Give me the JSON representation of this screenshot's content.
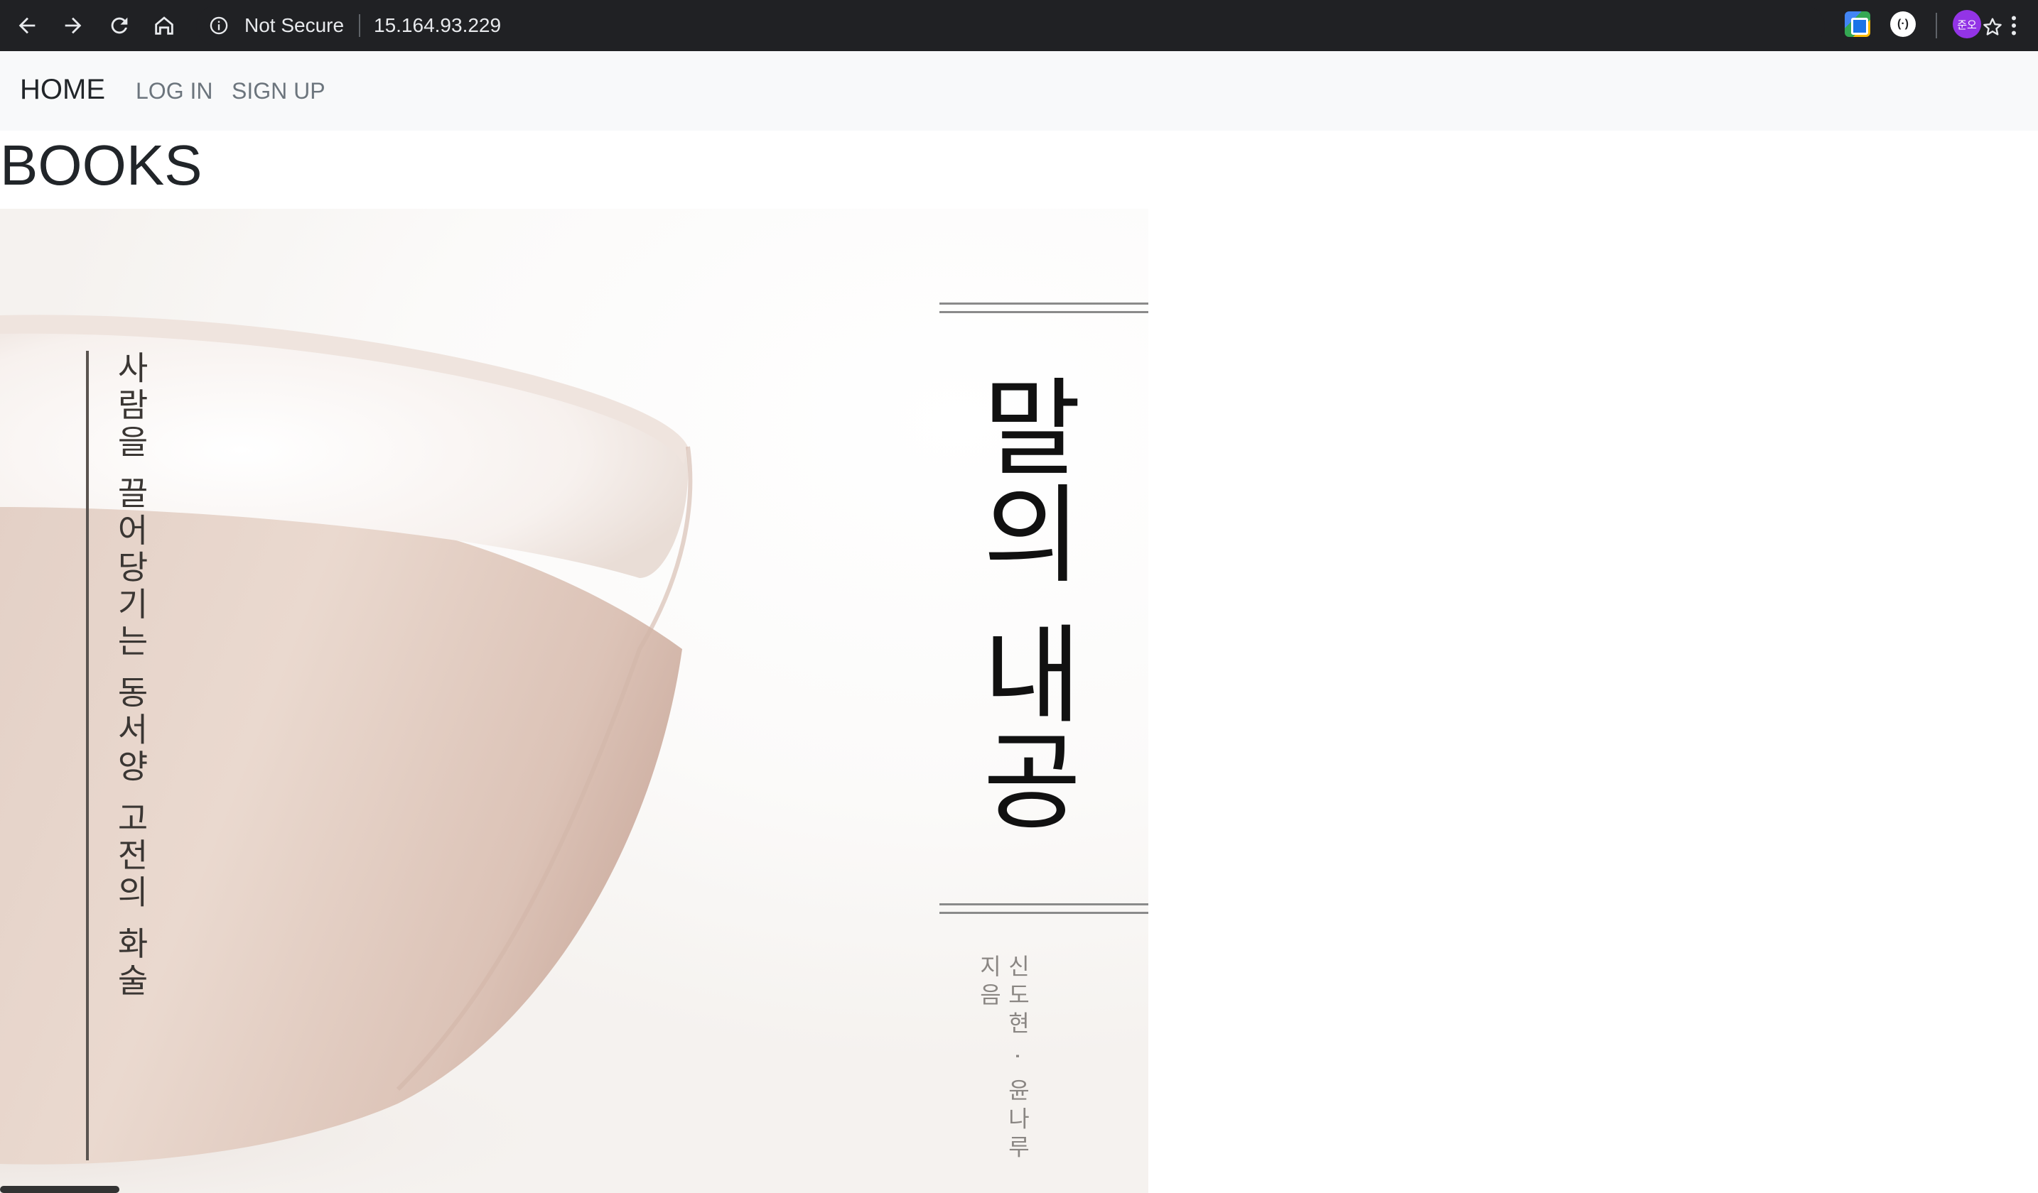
{
  "browser": {
    "security_label": "Not Secure",
    "url": "15.164.93.229",
    "avatar_label": "준오",
    "ext2_label": "(·)"
  },
  "nav": {
    "brand": "HOME",
    "links": [
      {
        "label": "LOG IN"
      },
      {
        "label": "SIGN UP"
      }
    ]
  },
  "main": {
    "heading": "BOOKS"
  },
  "book": {
    "title": "말의 내공",
    "subtitle": "사람을 끌어당기는 동서양 고전의 화술",
    "authors": "신도현 · 윤나루 지음"
  },
  "colors": {
    "chrome": "#202124",
    "navbar": "#f8f9fa",
    "text": "#212529",
    "muted_link": "#6c757d",
    "avatar": "#9334e6"
  }
}
